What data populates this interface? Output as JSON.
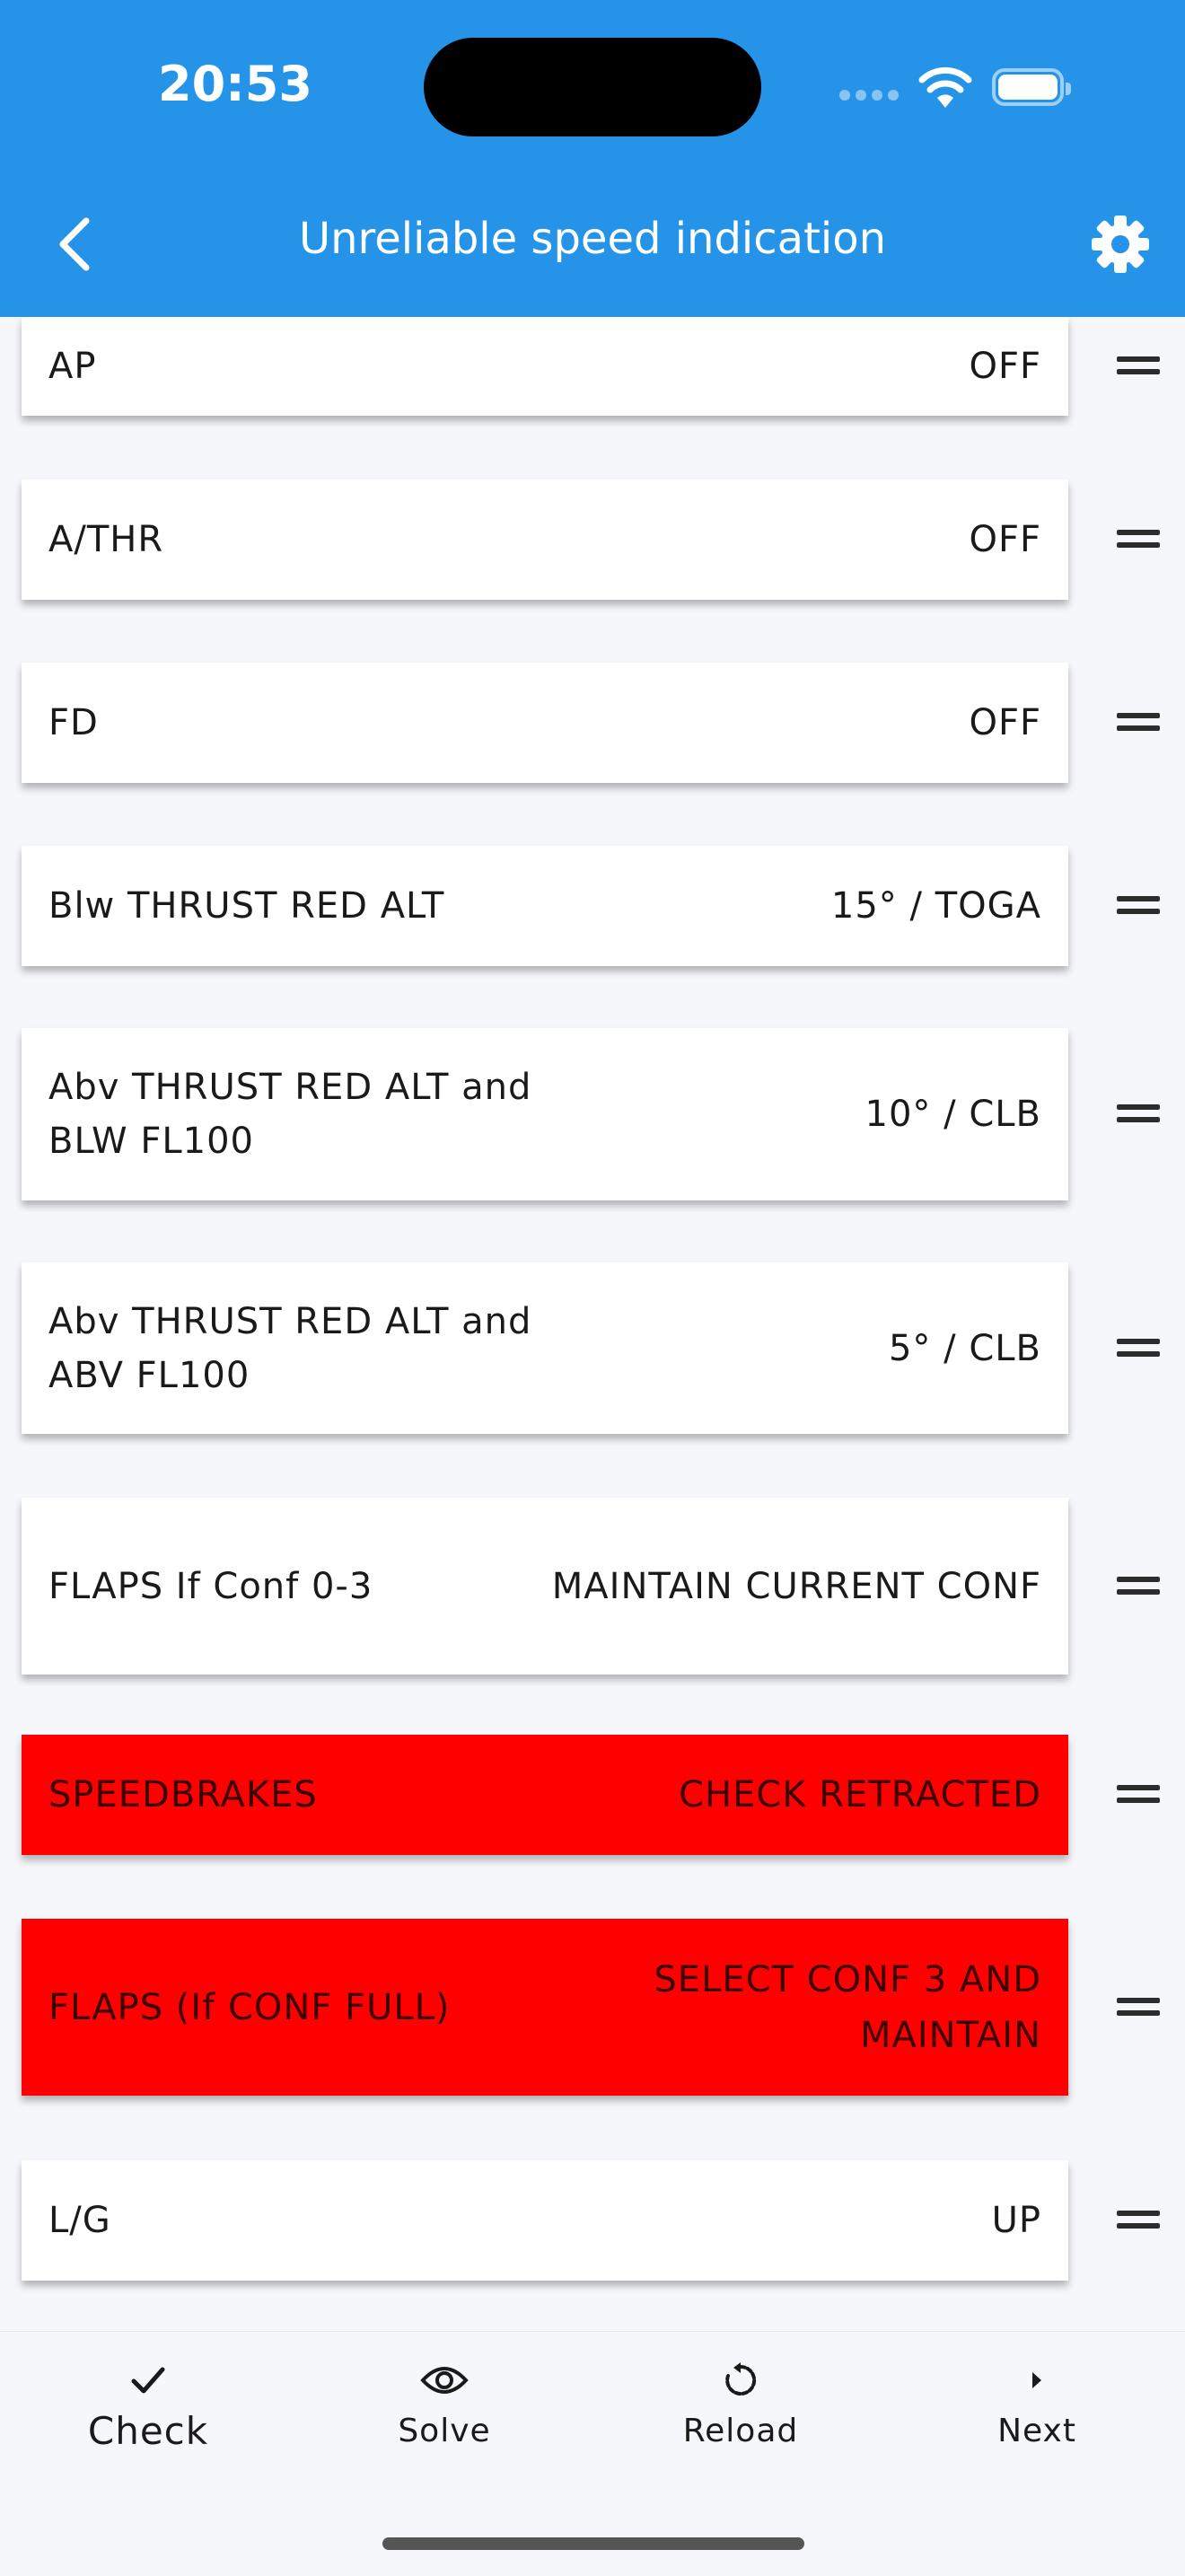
{
  "status_bar": {
    "time": "20:53"
  },
  "header": {
    "title": "Unreliable speed indication"
  },
  "items": [
    {
      "label": "AP",
      "value": "OFF",
      "alert": false
    },
    {
      "label": "A/THR",
      "value": "OFF",
      "alert": false
    },
    {
      "label": "FD",
      "value": "OFF",
      "alert": false
    },
    {
      "label": "Blw THRUST RED ALT",
      "value": "15° / TOGA",
      "alert": false
    },
    {
      "label": "Abv THRUST RED ALT and BLW FL100",
      "value": "10° / CLB",
      "alert": false
    },
    {
      "label": "Abv THRUST RED ALT and ABV FL100",
      "value": "5° / CLB",
      "alert": false
    },
    {
      "label": "FLAPS If Conf 0-3",
      "value": "MAINTAIN CURRENT CONF",
      "alert": false
    },
    {
      "label": "SPEEDBRAKES",
      "value": "CHECK RETRACTED",
      "alert": true
    },
    {
      "label": "FLAPS (If CONF FULL)",
      "value": "SELECT CONF 3 AND MAINTAIN",
      "alert": true
    },
    {
      "label": "L/G",
      "value": "UP",
      "alert": false
    }
  ],
  "bottom_nav": [
    {
      "label": "Check",
      "icon": "check-icon",
      "active": true
    },
    {
      "label": "Solve",
      "icon": "eye-icon",
      "active": false
    },
    {
      "label": "Reload",
      "icon": "reload-icon",
      "active": false
    },
    {
      "label": "Next",
      "icon": "next-arrow-icon",
      "active": false
    }
  ],
  "colors": {
    "app_bar": "#2594e8",
    "alert": "#ff0000",
    "card": "#ffffff"
  }
}
